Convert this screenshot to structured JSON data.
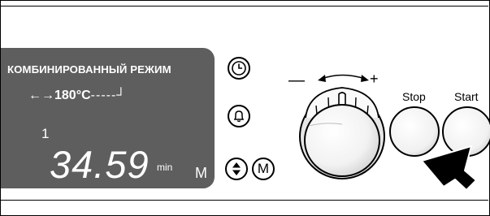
{
  "display": {
    "mode_text": "КОМБИНИРОВАННЫЙ РЕЖИМ",
    "arrows": "←→",
    "temperature": "180°C",
    "temp_tail": "-----┘",
    "program_number": "1",
    "time": "34.59",
    "time_unit": "min",
    "memory_indicator": "M"
  },
  "dial": {
    "minus": "—",
    "plus": "+"
  },
  "buttons": {
    "memory_label": "M",
    "stop_label": "Stop",
    "start_label": "Start"
  },
  "icons": [
    "clock-icon",
    "bell-icon",
    "up-down-arrows-icon",
    "pointer-arrow-icon"
  ]
}
